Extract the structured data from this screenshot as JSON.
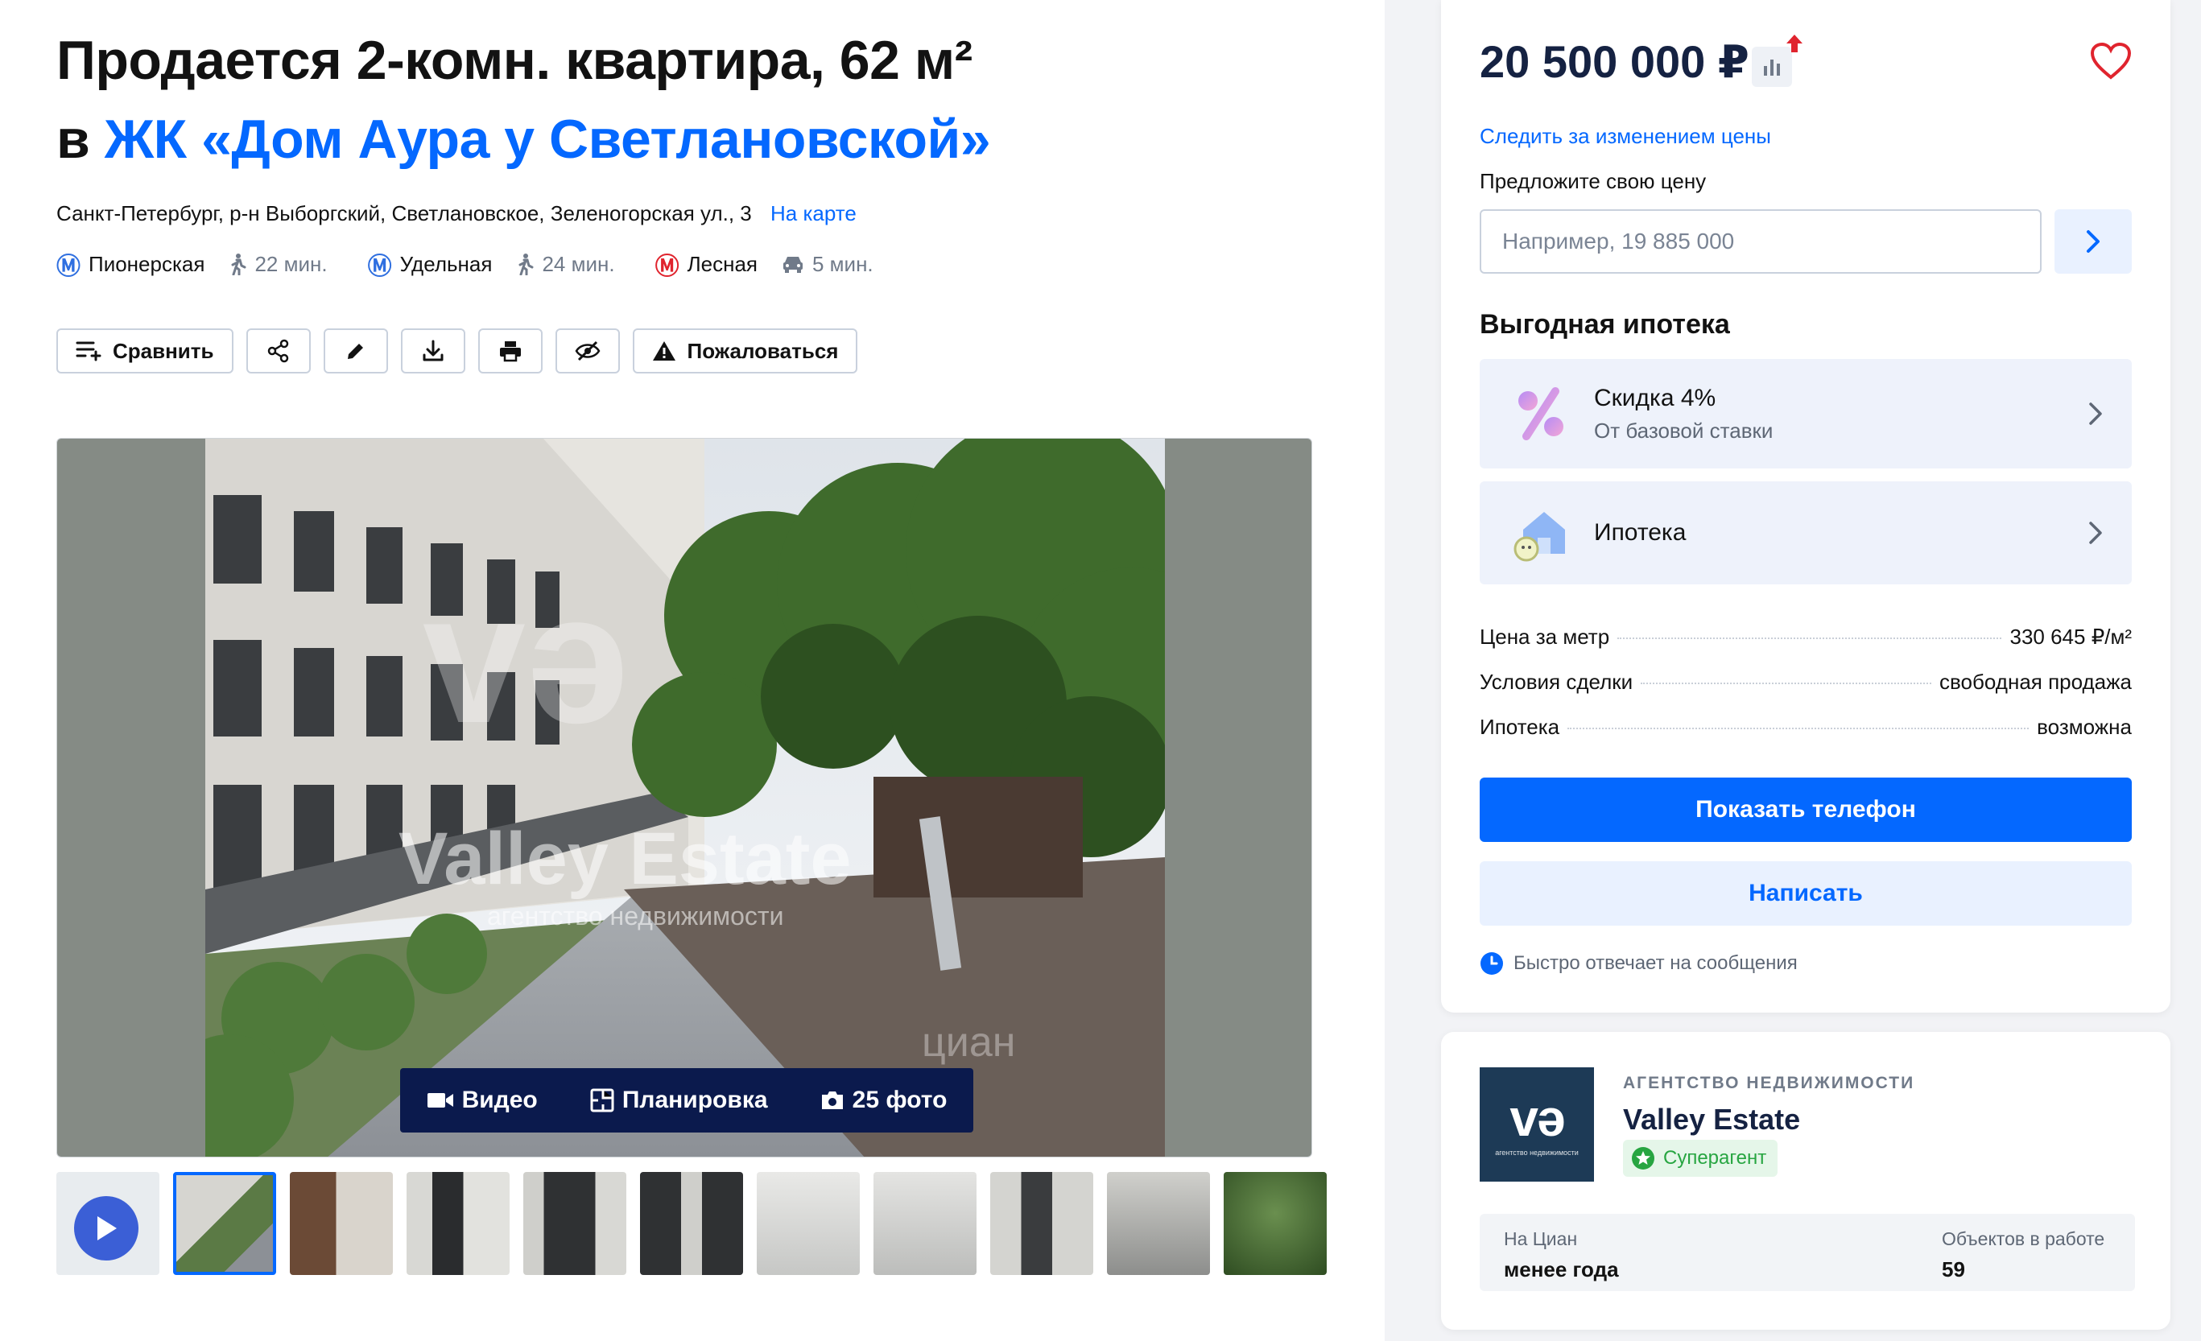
{
  "listing": {
    "title_line1": "Продается 2-комн. квартира, 62 м²",
    "title_prefix": "в",
    "title_complex": "ЖК «Дом Аура у Светлановской»",
    "address": "Санкт-Петербург, р-н Выборгский, Светлановское, Зеленогорская ул., 3",
    "map_link": "На карте",
    "metro": [
      {
        "name": "Пионерская",
        "time": "22 мин.",
        "mode": "walk",
        "color": "#2f6fe0"
      },
      {
        "name": "Удельная",
        "time": "24 мин.",
        "mode": "walk",
        "color": "#2f6fe0"
      },
      {
        "name": "Лесная",
        "time": "5 мин.",
        "mode": "car",
        "color": "#e0242e"
      }
    ]
  },
  "actions": {
    "compare": "Сравнить",
    "complain": "Пожаловаться",
    "icons": [
      "compare-icon",
      "share-icon",
      "edit-icon",
      "download-icon",
      "print-icon",
      "hide-icon",
      "warning-icon"
    ]
  },
  "gallery": {
    "watermark_brand": "Valley Estate",
    "watermark_sub": "агентство недвижимости",
    "watermark_cian": "циан",
    "media": {
      "video": "Видео",
      "plan": "Планировка",
      "photos": "25 фото"
    },
    "thumbnails_count": 11
  },
  "price_card": {
    "price": "20 500 000 ₽",
    "follow": "Следить за изменением цены",
    "offer_label": "Предложите свою цену",
    "offer_placeholder": "Например, 19 885 000",
    "mortgage_title": "Выгодная ипотека",
    "mortgage_items": [
      {
        "title": "Скидка 4%",
        "subtitle": "От базовой ставки"
      },
      {
        "title": "Ипотека"
      }
    ],
    "facts": [
      {
        "label": "Цена за метр",
        "value": "330 645 ₽/м²"
      },
      {
        "label": "Условия сделки",
        "value": "свободная продажа"
      },
      {
        "label": "Ипотека",
        "value": "возможна"
      }
    ],
    "show_phone": "Показать телефон",
    "write": "Написать",
    "fast_reply": "Быстро отвечает на сообщения"
  },
  "agent": {
    "kind": "АГЕНТСТВО НЕДВИЖИМОСТИ",
    "name": "Valley Estate",
    "badge": "Суперагент",
    "logo_text": "vә",
    "logo_sub": "агентство недвижимости",
    "stat1_label": "На Циан",
    "stat1_value": "менее года",
    "stat2_label": "Объектов в работе",
    "stat2_value": "59"
  },
  "colors": {
    "accent": "#0468ff",
    "dark": "#152242",
    "metro_blue": "#2f6fe0",
    "metro_red": "#e0242e"
  }
}
